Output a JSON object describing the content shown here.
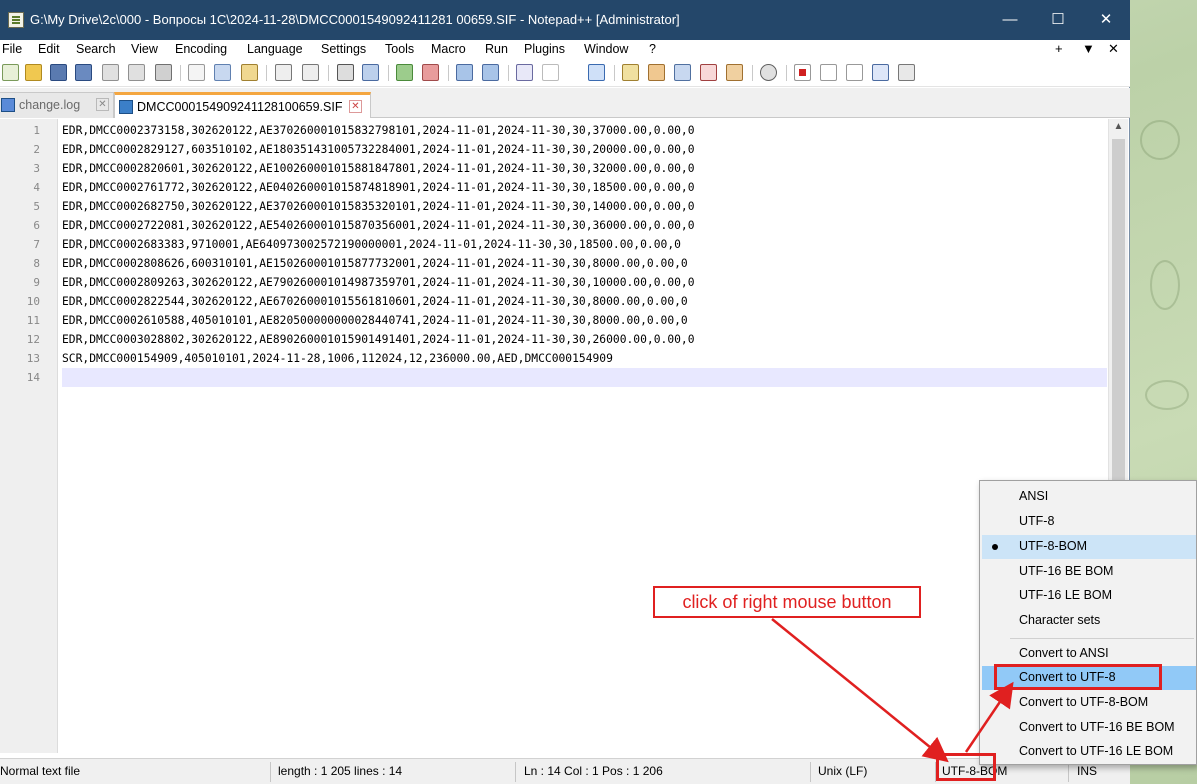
{
  "window": {
    "title": "G:\\My Drive\\2c\\000 - Вопросы 1С\\2024-11-28\\DMCC0001549092411281 00659.SIF - Notepad++ [Administrator]",
    "minimize": "—",
    "maximize": "☐",
    "close": "✕"
  },
  "menu": {
    "items": [
      "File",
      "Edit",
      "Search",
      "View",
      "Encoding",
      "Language",
      "Settings",
      "Tools",
      "Macro",
      "Run",
      "Plugins",
      "Window",
      "?"
    ],
    "right": [
      "+",
      "▼",
      "✕"
    ]
  },
  "tabs": [
    {
      "label": "change.log",
      "close": "✕"
    },
    {
      "label": "DMCC000154909241128100659.SIF",
      "close": "✕"
    }
  ],
  "editor": {
    "lines": [
      {
        "n": "1",
        "text": "EDR,DMCC0002373158,302620122,AE370260001015832798101,2024-11-01,2024-11-30,30,37000.00,0.00,0"
      },
      {
        "n": "2",
        "text": "EDR,DMCC0002829127,603510102,AE180351431005732284001,2024-11-01,2024-11-30,30,20000.00,0.00,0"
      },
      {
        "n": "3",
        "text": "EDR,DMCC0002820601,302620122,AE100260001015881847801,2024-11-01,2024-11-30,30,32000.00,0.00,0"
      },
      {
        "n": "4",
        "text": "EDR,DMCC0002761772,302620122,AE040260001015874818901,2024-11-01,2024-11-30,30,18500.00,0.00,0"
      },
      {
        "n": "5",
        "text": "EDR,DMCC0002682750,302620122,AE370260001015835320101,2024-11-01,2024-11-30,30,14000.00,0.00,0"
      },
      {
        "n": "6",
        "text": "EDR,DMCC0002722081,302620122,AE540260001015870356001,2024-11-01,2024-11-30,30,36000.00,0.00,0"
      },
      {
        "n": "7",
        "text": "EDR,DMCC0002683383,9710001,AE640973002572190000001,2024-11-01,2024-11-30,30,18500.00,0.00,0"
      },
      {
        "n": "8",
        "text": "EDR,DMCC0002808626,600310101,AE150260001015877732001,2024-11-01,2024-11-30,30,8000.00,0.00,0"
      },
      {
        "n": "9",
        "text": "EDR,DMCC0002809263,302620122,AE790260001014987359701,2024-11-01,2024-11-30,30,10000.00,0.00,0"
      },
      {
        "n": "10",
        "text": "EDR,DMCC0002822544,302620122,AE670260001015561810601,2024-11-01,2024-11-30,30,8000.00,0.00,0"
      },
      {
        "n": "11",
        "text": "EDR,DMCC0002610588,405010101,AE820500000000028440741,2024-11-01,2024-11-30,30,8000.00,0.00,0"
      },
      {
        "n": "12",
        "text": "EDR,DMCC0003028802,302620122,AE890260001015901491401,2024-11-01,2024-11-30,30,26000.00,0.00,0"
      },
      {
        "n": "13",
        "text": "SCR,DMCC000154909,405010101,2024-11-28,1006,112024,12,236000.00,AED,DMCC000154909"
      },
      {
        "n": "14",
        "text": ""
      }
    ],
    "scroll_up": "▲"
  },
  "status": {
    "file_type": "Normal text file",
    "length": "length : 1 205    lines : 14",
    "position": "Ln : 14    Col : 1    Pos : 1 206",
    "eol": "Unix (LF)",
    "encoding": "UTF-8-BOM",
    "mode": "INS"
  },
  "context_menu": {
    "group1": [
      "ANSI",
      "UTF-8",
      "UTF-8-BOM",
      "UTF-16 BE BOM",
      "UTF-16 LE BOM",
      "Character sets"
    ],
    "group2": [
      "Convert to ANSI",
      "Convert to UTF-8",
      "Convert to UTF-8-BOM",
      "Convert to UTF-16 BE BOM",
      "Convert to UTF-16 LE BOM"
    ],
    "checked": "UTF-8-BOM",
    "highlighted": "Convert to UTF-8"
  },
  "annotation": {
    "callout": "click of right mouse button",
    "color": "#e02020"
  },
  "colors": {
    "titlebar": "#24476a",
    "active_tab_accent": "#f4a640",
    "current_line": "#e8e8ff",
    "menu_hover": "#91c9f7"
  }
}
